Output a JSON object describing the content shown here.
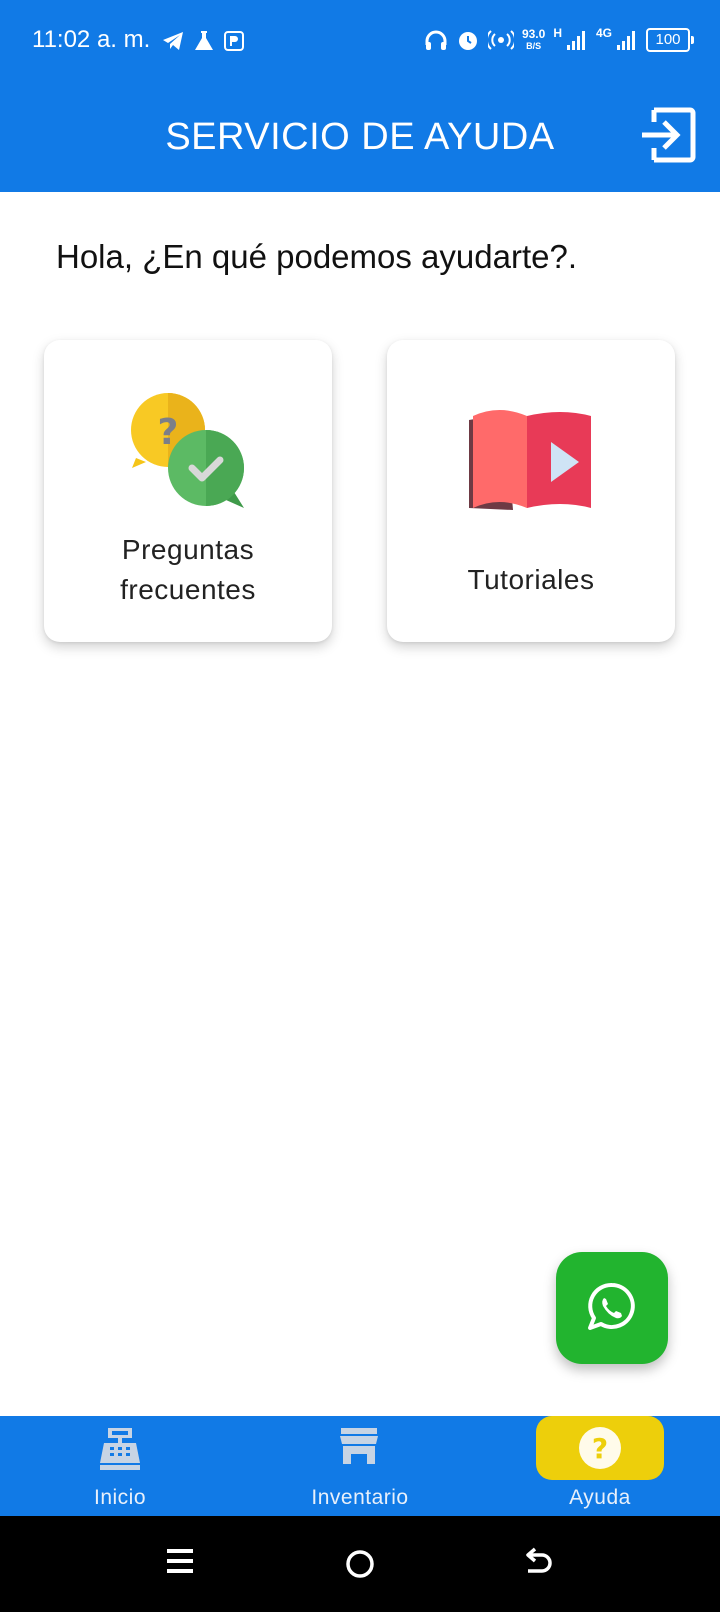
{
  "status_bar": {
    "time": "11:02 a. m.",
    "speed_value": "93.0",
    "speed_unit": "B/S",
    "network_h": "H",
    "network_4g": "4G",
    "battery": "100"
  },
  "header": {
    "title": "SERVICIO DE AYUDA",
    "logout_icon": "logout-icon"
  },
  "greeting": "Hola, ¿En qué podemos ayudarte?.",
  "cards": {
    "faq": {
      "label_line1": "Preguntas",
      "label_line2": "frecuentes",
      "icon": "faq-chat-icon"
    },
    "tutorials": {
      "label": "Tutoriales",
      "icon": "video-book-icon"
    }
  },
  "fab": {
    "icon": "whatsapp-icon"
  },
  "bottom_nav": {
    "items": [
      {
        "label": "Inicio",
        "icon": "cash-register-icon"
      },
      {
        "label": "Inventario",
        "icon": "store-icon"
      },
      {
        "label": "Ayuda",
        "icon": "help-icon",
        "active": true
      }
    ]
  },
  "colors": {
    "primary": "#117ae6",
    "active_pill": "#edcf0b",
    "whatsapp": "#22b42f"
  }
}
